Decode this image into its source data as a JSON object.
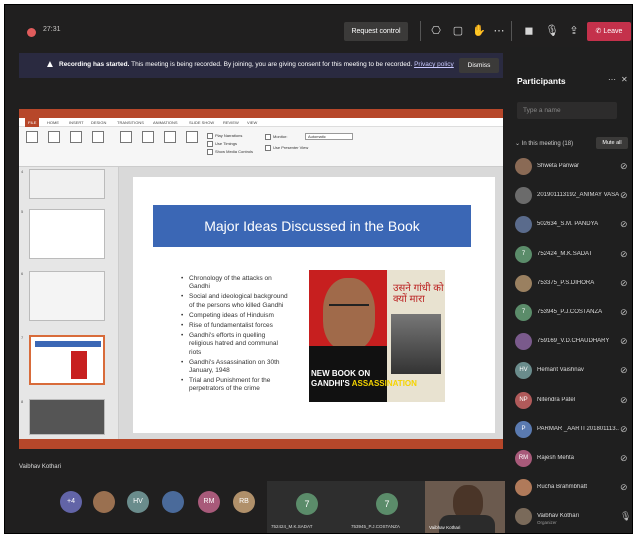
{
  "topbar": {
    "timer": "27:31",
    "request_control": "Request control",
    "leave_label": "Leave",
    "icons": [
      "camera-icon",
      "share-icon",
      "raise-hand-icon",
      "more-icon",
      "video-off-icon",
      "mic-off-icon",
      "share-screen-icon"
    ]
  },
  "banner": {
    "title": "Recording has started.",
    "text": "This meeting is being recorded. By joining, you are giving consent for this meeting to be recorded.",
    "link": "Privacy policy",
    "dismiss": "Dismiss"
  },
  "presentation": {
    "slide_title": "Major Ideas Discussed in the Book",
    "bullets": [
      "Chronology of the attacks on Gandhi",
      "Social and ideological background of the persons who killed Gandhi",
      "Competing ideas of Hinduism",
      "Rise of fundamentalist forces",
      "Gandhi's efforts in quelling religious hatred and communal riots",
      "Gandhi's Assassination on 30th January, 1948",
      "Trial and Punishment for the perpetrators of the crime"
    ],
    "book_title": "उसने गांधी को क्यों मारा",
    "caption_line1": "NEW BOOK ON",
    "caption_line2_a": "GANDHI'S ",
    "caption_line2_b": "ASSASSINATION",
    "ribbon_tabs": [
      "FILE",
      "HOME",
      "INSERT",
      "DESIGN",
      "TRANSITIONS",
      "ANIMATIONS",
      "SLIDE SHOW",
      "REVIEW",
      "VIEW"
    ],
    "monitor_label": "Monitor:",
    "monitor_value": "Automatic",
    "use_presenter": "Use Presenter View",
    "play_narrations": "Play Narrations",
    "use_timings": "Use Timings",
    "show_media": "Show Media Controls",
    "slide_numbers": [
      "4",
      "5",
      "6",
      "7",
      "8",
      "9"
    ]
  },
  "presenter_name": "Vaibhav Kothari",
  "participants": {
    "title": "Participants",
    "search_placeholder": "Type a name",
    "in_meeting": "In this meeting (18)",
    "mute_all": "Mute all",
    "list": [
      {
        "name": "Shweta Panwar",
        "initials": "",
        "color": "#8a6a55"
      },
      {
        "name": "201901113192_ANIMAY VASA...",
        "initials": "",
        "color": "#6b6b6b"
      },
      {
        "name": "502634_S.M. PANDYA",
        "initials": "",
        "color": "#5a6b8c"
      },
      {
        "name": "752424_M.K.SADAT",
        "initials": "7",
        "color": "#5b8c6a"
      },
      {
        "name": "753375_P.S.DIHORA",
        "initials": "",
        "color": "#9a8060"
      },
      {
        "name": "753945_P.J.COSTANZA",
        "initials": "7",
        "color": "#5b8c6a"
      },
      {
        "name": "759169_V.D.CHAUDHARY",
        "initials": "",
        "color": "#7a5a8c"
      },
      {
        "name": "Hemant Vaishnav",
        "initials": "HV",
        "color": "#6a8c8c"
      },
      {
        "name": "Nitendra Patel",
        "initials": "NP",
        "color": "#b05a5a"
      },
      {
        "name": "PARMAR _AARTI 201801113...",
        "initials": "P",
        "color": "#5a7ab0"
      },
      {
        "name": "Rajesh Mehta",
        "initials": "RM",
        "color": "#a85a7a"
      },
      {
        "name": "Rucha Brahmbhatt",
        "initials": "",
        "color": "#b07a5a"
      },
      {
        "name": "Vaibhav Kothari",
        "initials": "",
        "color": "#7a6a5a",
        "role": "Organizer"
      }
    ]
  },
  "strip": {
    "overflow": "+4",
    "avatars": [
      {
        "initials": "",
        "color": "#9a7050"
      },
      {
        "initials": "HV",
        "color": "#6a8c8c"
      },
      {
        "initials": "",
        "color": "#4a6a9a"
      },
      {
        "initials": "RM",
        "color": "#a85a7a"
      },
      {
        "initials": "RB",
        "color": "#b0906a"
      }
    ],
    "tiles": [
      {
        "initials": "7",
        "name": "752424_M.K.SADAT"
      },
      {
        "initials": "7",
        "name": "753945_P.J.COSTANZA"
      }
    ],
    "video_name": "Vaibhav Kothari"
  }
}
